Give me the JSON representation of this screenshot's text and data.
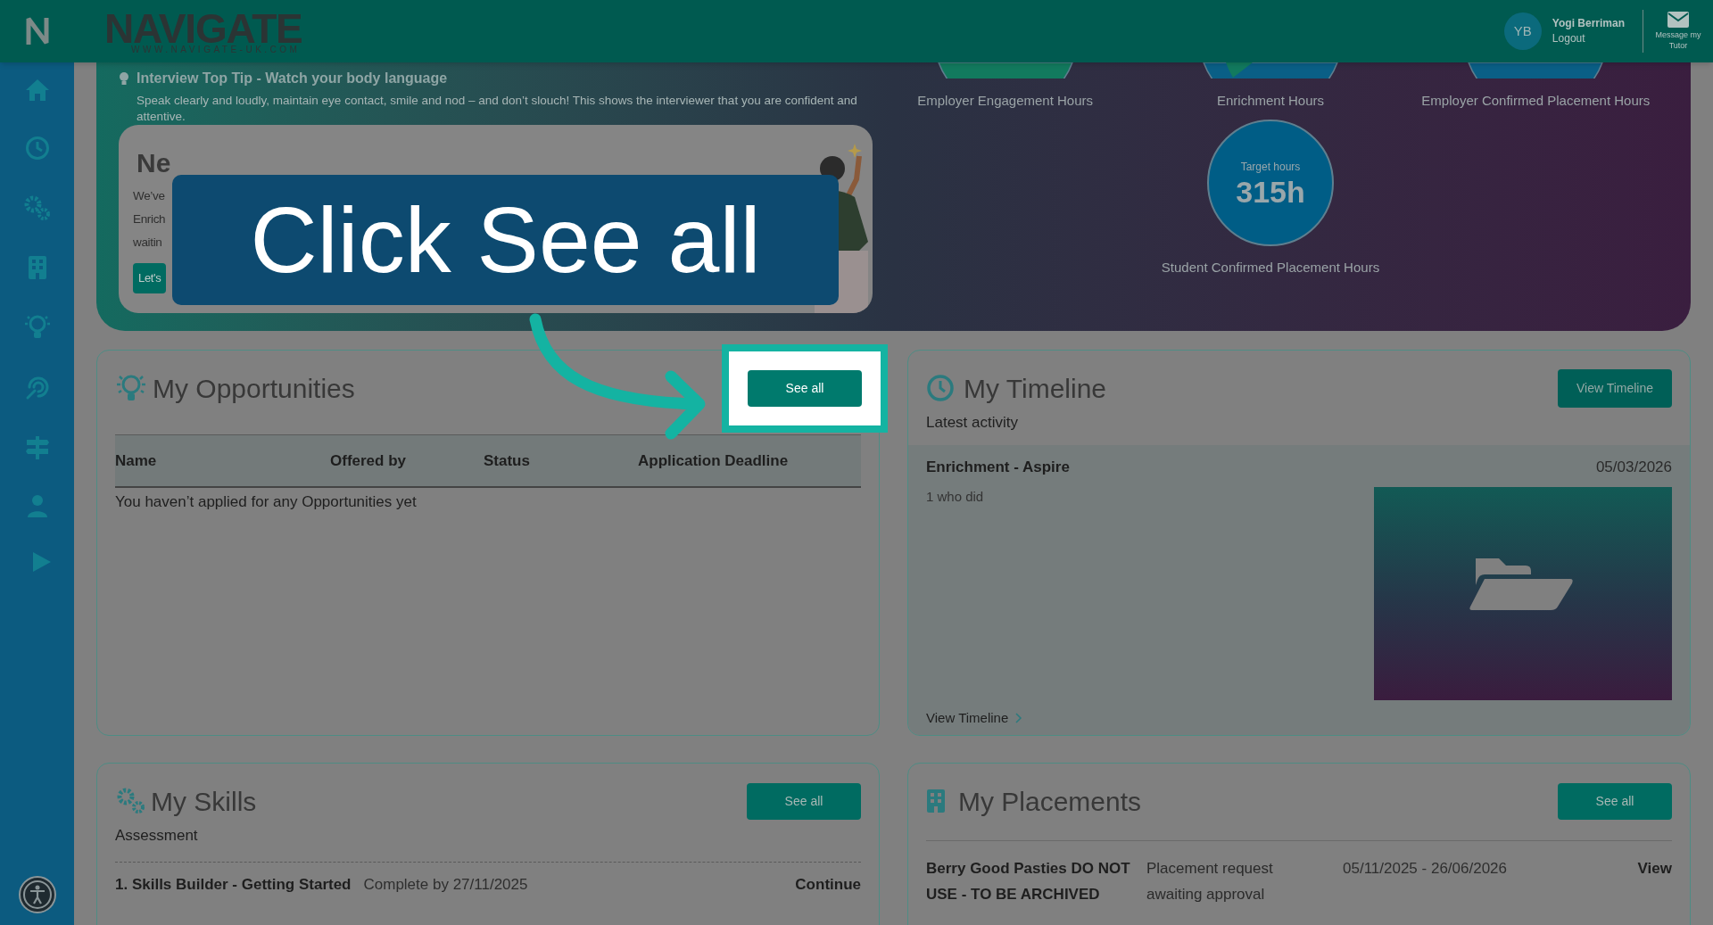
{
  "header": {
    "logo": "NAVIGATE",
    "logo_tagline": "WWW.NAVIGATE-UK.COM",
    "avatar_initials": "YB",
    "user_name": "Yogi Berriman",
    "logout": "Logout",
    "message_button": "Message my Tutor"
  },
  "banner": {
    "tip_title": "Interview Top Tip - Watch your body language",
    "tip_text": "Speak clearly and loudly, maintain eye contact, smile and nod – and don’t slouch! This shows the interviewer that you are confident and attentive.",
    "opportunity_card": {
      "title": "Ne",
      "lines": [
        "We’ve",
        "Enrich",
        "waitin"
      ],
      "button": "Let's"
    },
    "hours": [
      {
        "label": "Employer Engagement Hours"
      },
      {
        "label": "Enrichment Hours"
      },
      {
        "label": "Employer Confirmed Placement Hours"
      }
    ],
    "target": {
      "caption": "Target hours",
      "value": "315h",
      "label": "Student Confirmed Placement Hours"
    }
  },
  "callout": {
    "text": "Click See all"
  },
  "opportunities": {
    "title": "My Opportunities",
    "button": "See all",
    "highlighted": true,
    "columns": [
      "Name",
      "Offered by",
      "Status",
      "Application Deadline"
    ],
    "empty_message": "You haven’t applied for any Opportunities yet"
  },
  "timeline": {
    "title": "My Timeline",
    "button": "View Timeline",
    "subtitle": "Latest activity",
    "entry": {
      "title": "Enrichment - Aspire",
      "date": "05/03/2026",
      "text": "1 who did",
      "kind": "picture"
    },
    "link": "View Timeline"
  },
  "skills": {
    "title": "My Skills",
    "button": "See all",
    "subtitle": "Assessment",
    "rows": [
      {
        "name": "1. Skills Builder - Getting Started",
        "due": "Complete by 27/11/2025",
        "action": "Continue"
      }
    ]
  },
  "placements": {
    "title": "My Placements",
    "button": "See all",
    "rows": [
      {
        "name": "Berry Good Pasties DO NOT USE - TO BE ARCHIVED",
        "status": "Placement request awaiting approval",
        "dates": "05/11/2025 - 26/06/2026",
        "action": "View"
      }
    ]
  }
}
